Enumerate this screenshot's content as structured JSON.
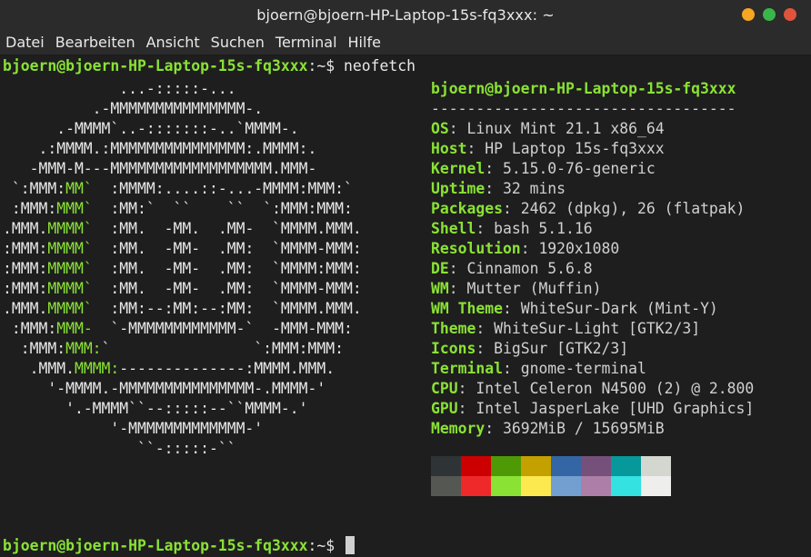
{
  "window": {
    "title": "bjoern@bjoern-HP-Laptop-15s-fq3xxx: ~"
  },
  "menu": [
    "Datei",
    "Bearbeiten",
    "Ansicht",
    "Suchen",
    "Terminal",
    "Hilfe"
  ],
  "prompt": {
    "user_host": "bjoern@bjoern-HP-Laptop-15s-fq3xxx",
    "path": ":~$",
    "command": "neofetch"
  },
  "ascii_lines": [
    "             ...-:::::-...",
    "          .-MMMMMMMMMMMMMMM-.",
    "      .-MMMM`..-:::::::-..`MMMM-.",
    "    .:MMMM.:MMMMMMMMMMMMMMM:.MMMM:.",
    "   -MMM-M---MMMMMMMMMMMMMMMMMM.MMM-",
    " `:MMM:MM`  :MMMM:....::-...-MMMM:MMM:`",
    " :MMM:MMM`  :MM:`  ``    ``  `:MMM:MMM:",
    ".MMM.MMMM`  :MM.  -MM.  .MM-  `MMMM.MMM.",
    ":MMM:MMMM`  :MM.  -MM-  .MM:  `MMMM-MMM:",
    ":MMM:MMMM`  :MM.  -MM-  .MM:  `MMMM:MMM:",
    ":MMM:MMMM`  :MM.  -MM-  .MM:  `MMMM-MMM:",
    ".MMM.MMMM`  :MM:--:MM:--:MM:  `MMMM.MMM.",
    " :MMM:MMM-  `-MMMMMMMMMMMM-`  -MMM-MMM:",
    "  :MMM:MMM:`                `:MMM:MMM:",
    "   .MMM.MMMM:--------------:MMMM.MMM.",
    "     '-MMMM.-MMMMMMMMMMMMMMM-.MMMM-'",
    "       '.-MMMM``--:::::--``MMMM-.'",
    "            '-MMMMMMMMMMMMM-'",
    "               ``-:::::-``"
  ],
  "info": {
    "header": "bjoern@bjoern-HP-Laptop-15s-fq3xxx",
    "separator": "----------------------------------",
    "rows": [
      {
        "key": "OS",
        "value": "Linux Mint 21.1 x86_64"
      },
      {
        "key": "Host",
        "value": "HP Laptop 15s-fq3xxx"
      },
      {
        "key": "Kernel",
        "value": "5.15.0-76-generic"
      },
      {
        "key": "Uptime",
        "value": "32 mins"
      },
      {
        "key": "Packages",
        "value": "2462 (dpkg), 26 (flatpak)"
      },
      {
        "key": "Shell",
        "value": "bash 5.1.16"
      },
      {
        "key": "Resolution",
        "value": "1920x1080"
      },
      {
        "key": "DE",
        "value": "Cinnamon 5.6.8"
      },
      {
        "key": "WM",
        "value": "Mutter (Muffin)"
      },
      {
        "key": "WM Theme",
        "value": "WhiteSur-Dark (Mint-Y)"
      },
      {
        "key": "Theme",
        "value": "WhiteSur-Light [GTK2/3]"
      },
      {
        "key": "Icons",
        "value": "BigSur [GTK2/3]"
      },
      {
        "key": "Terminal",
        "value": "gnome-terminal"
      },
      {
        "key": "CPU",
        "value": "Intel Celeron N4500 (2) @ 2.800"
      },
      {
        "key": "GPU",
        "value": "Intel JasperLake [UHD Graphics]"
      },
      {
        "key": "Memory",
        "value": "3692MiB / 15695MiB"
      }
    ]
  },
  "palette": [
    "#2e3436",
    "#cc0000",
    "#4e9a06",
    "#c4a000",
    "#3465a4",
    "#75507b",
    "#06989a",
    "#d3d7cf",
    "#555753",
    "#ef2929",
    "#8ae234",
    "#fce94f",
    "#729fcf",
    "#ad7fa8",
    "#34e2e2",
    "#eeeeec"
  ],
  "bottom_prompt": {
    "user_host": "bjoern@bjoern-HP-Laptop-15s-fq3xxx",
    "path": ":~$"
  }
}
